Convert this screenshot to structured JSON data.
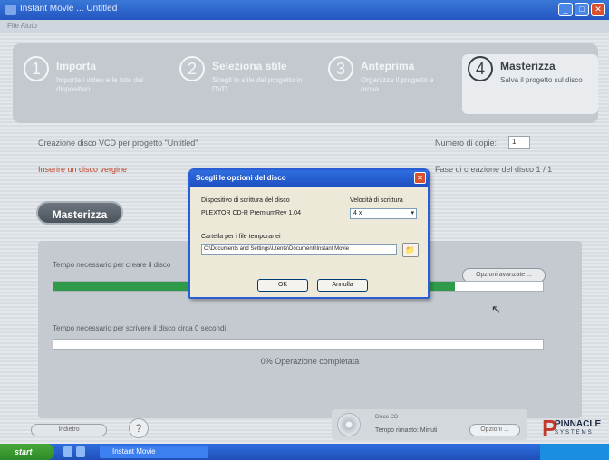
{
  "window": {
    "title": "Instant Movie ... Untitled",
    "menu": "File  Aiuto",
    "buttons": {
      "minimize": "_",
      "maximize": "□",
      "close": "✕"
    }
  },
  "steps": [
    {
      "number": "1",
      "name": "Importa",
      "desc": "Importa i video e le foto dal dispositivo",
      "active": false
    },
    {
      "number": "2",
      "name": "Seleziona stile",
      "desc": "Scegli lo stile del progetto in DVD",
      "active": false
    },
    {
      "number": "3",
      "name": "Anteprima",
      "desc": "Organizza il progetto e prova",
      "active": false
    },
    {
      "number": "4",
      "name": "Masterizza",
      "desc": "Salva il progetto sul disco",
      "active": true
    }
  ],
  "burn": {
    "disc_label": "Creazione disco VCD per progetto \"Untitled\"",
    "copies_label": "Numero di copie:",
    "copies_value": "1",
    "warning": "Inserire un disco vergine",
    "phase_label": "Fase di creazione del disco 1 / 1",
    "burn_button": "Masterizza"
  },
  "progress": {
    "label1": "Tempo necessario per creare il disco",
    "details_button": "Opzioni avanzate ...",
    "bar1_fraction": 0.82,
    "label2": "Tempo necessario per scrivere il disco circa 0 secondi",
    "bar2_fraction": 0.0,
    "percent_text": "0% Operazione completata"
  },
  "dialog": {
    "title": "Scegli le opzioni del disco",
    "close": "✕",
    "device_label": "Dispositivo di scrittura del disco",
    "device_value": "PLEXTOR CD-R   PremiumRev 1.04",
    "speed_label": "Velocità di scrittura",
    "speed_value": "4 x",
    "speed_arrow": "▾",
    "folder_label": "Cartella per i file temporanei",
    "folder_path": "C:\\Documents and Settings\\Utente\\Documenti\\Instant Movie",
    "folder_icon": "📁",
    "ok": "OK",
    "cancel": "Annulla"
  },
  "bottom": {
    "back_button": "Indietro",
    "help_icon": "?",
    "info_small": "Disco CD",
    "remaining": "Tempo rimasto: Minuti",
    "options_button": "Opzioni ...",
    "logo_letter": "P",
    "logo_brand": "PINNACLE",
    "logo_sub": "SYSTEMS"
  },
  "taskbar": {
    "start": "start",
    "task": "Instant Movie"
  },
  "colors": {
    "accent_blue": "#2a5cd6",
    "progress_green": "#2f9a4a",
    "warning_red": "#c2452a"
  }
}
